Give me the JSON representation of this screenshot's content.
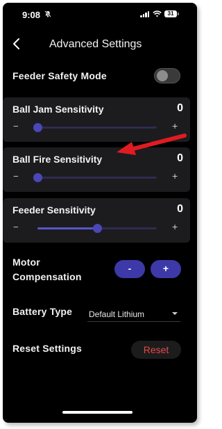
{
  "status_bar": {
    "time": "9:08",
    "battery_level": "31"
  },
  "header": {
    "title": "Advanced Settings"
  },
  "feeder_safety_mode": {
    "label": "Feeder Safety Mode",
    "enabled": false
  },
  "sliders": [
    {
      "label": "Ball Jam Sensitivity",
      "value": "0",
      "fill_fraction": 0.0,
      "minus": "−",
      "plus": "+"
    },
    {
      "label": "Ball Fire Sensitivity",
      "value": "0",
      "fill_fraction": 0.0,
      "minus": "−",
      "plus": "+"
    },
    {
      "label": "Feeder Sensitivity",
      "value": "0",
      "fill_fraction": 0.5,
      "minus": "−",
      "plus": "+"
    }
  ],
  "motor_compensation": {
    "label_line1": "Motor",
    "label_line2": "Compensation",
    "minus_label": "-",
    "plus_label": "+"
  },
  "battery_type": {
    "label": "Battery Type",
    "selected": "Default Lithium"
  },
  "reset_settings": {
    "label": "Reset Settings",
    "button_label": "Reset"
  },
  "colors": {
    "accent": "#3d39a8",
    "track": "#2e2c52",
    "danger": "#e8484a",
    "annotation_arrow": "#e01b22"
  }
}
